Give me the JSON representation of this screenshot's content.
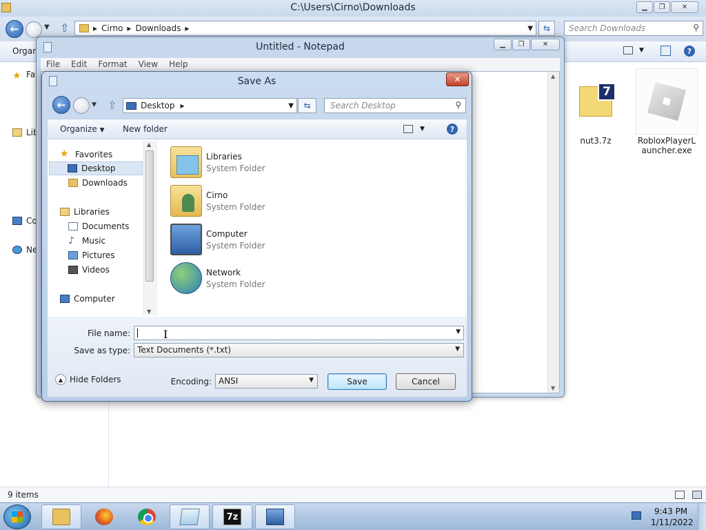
{
  "explorer": {
    "window_title": "C:\\Users\\Cirno\\Downloads",
    "address": [
      "Cirno",
      "Downloads"
    ],
    "search_placeholder": "Search Downloads",
    "organize_label": "Organ",
    "nav_items": [
      "Fa",
      "Lib",
      "Co",
      "Ne"
    ],
    "files": [
      {
        "name": "nut3.7z",
        "icon": "7zip-archive-icon"
      },
      {
        "name": "RobloxPlayerLauncher.exe",
        "icon": "roblox-icon"
      }
    ],
    "status_count": "9 items"
  },
  "notepad": {
    "title": "Untitled - Notepad",
    "menu": [
      "File",
      "Edit",
      "Format",
      "View",
      "Help"
    ]
  },
  "dialog": {
    "title": "Save As",
    "location": "Desktop",
    "search_placeholder": "Search Desktop",
    "organize_label": "Organize",
    "new_folder_label": "New folder",
    "nav": {
      "favorites": "Favorites",
      "desktop": "Desktop",
      "downloads": "Downloads",
      "libraries": "Libraries",
      "documents": "Documents",
      "music": "Music",
      "pictures": "Pictures",
      "videos": "Videos",
      "computer": "Computer"
    },
    "items": [
      {
        "name": "Libraries",
        "type": "System Folder"
      },
      {
        "name": "Cirno",
        "type": "System Folder"
      },
      {
        "name": "Computer",
        "type": "System Folder"
      },
      {
        "name": "Network",
        "type": "System Folder"
      }
    ],
    "file_name_label": "File name:",
    "file_name_value": "",
    "save_type_label": "Save as type:",
    "save_type_value": "Text Documents (*.txt)",
    "encoding_label": "Encoding:",
    "encoding_value": "ANSI",
    "hide_folders_label": "Hide Folders",
    "save_label": "Save",
    "cancel_label": "Cancel"
  },
  "taskbar": {
    "apps": [
      "windows-explorer",
      "firefox",
      "chrome",
      "notepad",
      "7-zip",
      "network-manager"
    ],
    "time": "9:43 PM",
    "date": "1/11/2022"
  }
}
